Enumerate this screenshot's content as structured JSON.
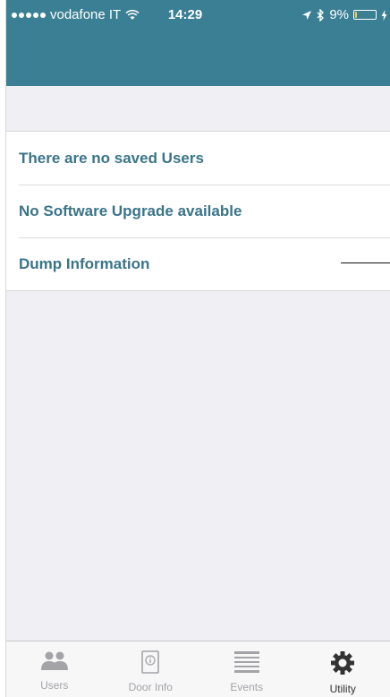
{
  "status_bar": {
    "carrier": "vodafone IT",
    "time": "14:29",
    "battery": "9%",
    "battery_level": 0.09
  },
  "list": {
    "items": [
      {
        "label": "There are no saved Users"
      },
      {
        "label": "No Software Upgrade available"
      },
      {
        "label": "Dump Information"
      }
    ]
  },
  "tabs": [
    {
      "label": "Users",
      "icon": "users-icon"
    },
    {
      "label": "Door Info",
      "icon": "door-info-icon"
    },
    {
      "label": "Events",
      "icon": "events-icon"
    },
    {
      "label": "Utility",
      "icon": "gear-icon",
      "active": true
    }
  ],
  "colors": {
    "header": "#3a7f94",
    "row_text": "#3a7488",
    "background": "#efeff4"
  }
}
